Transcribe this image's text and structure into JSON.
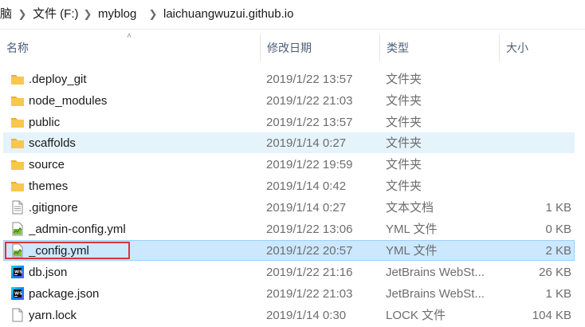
{
  "breadcrumb": {
    "items": [
      "脑",
      "文件 (F:)",
      "myblog",
      "laichuangwuzui.github.io"
    ]
  },
  "columns": {
    "name": "名称",
    "date": "修改日期",
    "type": "类型",
    "size": "大小"
  },
  "files": [
    {
      "name": ".deploy_git",
      "date": "2019/1/22 13:57",
      "type": "文件夹",
      "size": "",
      "icon": "folder-icon",
      "state": "normal"
    },
    {
      "name": "node_modules",
      "date": "2019/1/22 21:03",
      "type": "文件夹",
      "size": "",
      "icon": "folder-icon",
      "state": "normal"
    },
    {
      "name": "public",
      "date": "2019/1/22 13:57",
      "type": "文件夹",
      "size": "",
      "icon": "folder-icon",
      "state": "normal"
    },
    {
      "name": "scaffolds",
      "date": "2019/1/14 0:27",
      "type": "文件夹",
      "size": "",
      "icon": "folder-icon",
      "state": "hover"
    },
    {
      "name": "source",
      "date": "2019/1/22 19:59",
      "type": "文件夹",
      "size": "",
      "icon": "folder-icon",
      "state": "normal"
    },
    {
      "name": "themes",
      "date": "2019/1/14 0:42",
      "type": "文件夹",
      "size": "",
      "icon": "folder-icon",
      "state": "normal"
    },
    {
      "name": ".gitignore",
      "date": "2019/1/14 0:27",
      "type": "文本文档",
      "size": "1 KB",
      "icon": "text-file-icon",
      "state": "normal"
    },
    {
      "name": "_admin-config.yml",
      "date": "2019/1/22 13:06",
      "type": "YML 文件",
      "size": "0 KB",
      "icon": "yml-file-icon",
      "state": "normal"
    },
    {
      "name": "_config.yml",
      "date": "2019/1/22 20:57",
      "type": "YML 文件",
      "size": "2 KB",
      "icon": "yml-file-icon",
      "state": "selected"
    },
    {
      "name": "db.json",
      "date": "2019/1/22 21:16",
      "type": "JetBrains WebSt...",
      "size": "26 KB",
      "icon": "webstorm-file-icon",
      "state": "normal"
    },
    {
      "name": "package.json",
      "date": "2019/1/22 21:03",
      "type": "JetBrains WebSt...",
      "size": "1 KB",
      "icon": "webstorm-file-icon",
      "state": "normal"
    },
    {
      "name": "yarn.lock",
      "date": "2019/1/14 0:30",
      "type": "LOCK 文件",
      "size": "104 KB",
      "icon": "generic-file-icon",
      "state": "normal"
    }
  ],
  "colors": {
    "folder": "#f8c74c",
    "selected_bg": "#cce8ff",
    "selected_border": "#99d1ff",
    "hover_bg": "#e5f3fb",
    "annotation_box": "#e0303a",
    "header_text": "#4c607a"
  }
}
